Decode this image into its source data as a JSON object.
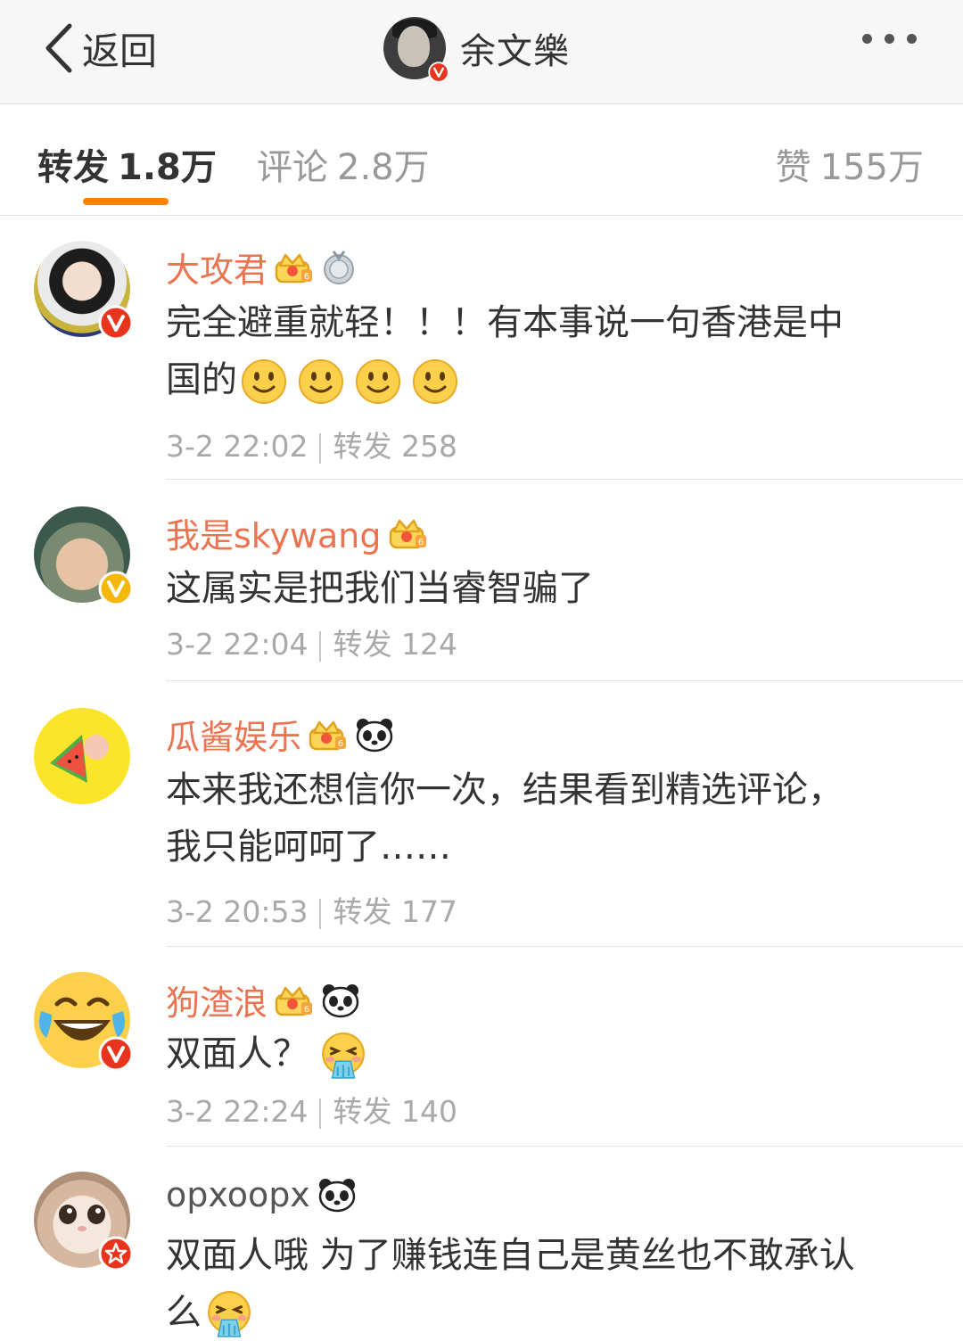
{
  "header": {
    "back_label": "返回",
    "title": "余文樂",
    "more_icon": "more-dots-icon"
  },
  "tabs": [
    {
      "label": "转发",
      "count": "1.8万",
      "active": true
    },
    {
      "label": "评论",
      "count": "2.8万",
      "active": false
    },
    {
      "label": "赞",
      "count": "155万",
      "active": false
    }
  ],
  "colors": {
    "accent": "#ff8200",
    "username": "#eb7350",
    "verified_red": "#e8341c",
    "verified_yellow": "#f5b70a"
  },
  "comments": [
    {
      "username": "大攻君",
      "badges": [
        "crown-vip-icon",
        "medal-icon"
      ],
      "verify": "verified-red-icon",
      "text_line1": "完全避重就轻！！！有本事说一句香港是中",
      "text_line2": "国的",
      "emoji": [
        "smile-emoji-icon",
        "smile-emoji-icon",
        "smile-emoji-icon",
        "smile-emoji-icon"
      ],
      "time": "3-2 22:02",
      "repost_label": "转发",
      "repost_count": "258"
    },
    {
      "username": "我是skywang",
      "badges": [
        "crown-vip-icon"
      ],
      "verify": "verified-yellow-icon",
      "text_line1": "这属实是把我们当睿智骗了",
      "time": "3-2 22:04",
      "repost_label": "转发",
      "repost_count": "124"
    },
    {
      "username": "瓜酱娱乐",
      "badges": [
        "crown-vip-icon",
        "panda-icon"
      ],
      "verify": "",
      "text_line1": "本来我还想信你一次，结果看到精选评论，",
      "text_line2": "我只能呵呵了……",
      "time": "3-2 20:53",
      "repost_label": "转发",
      "repost_count": "177"
    },
    {
      "username": "狗渣浪",
      "badges": [
        "crown-vip-icon",
        "panda-icon"
      ],
      "verify": "verified-red-icon",
      "text_line1": "双面人？",
      "emoji": [
        "vomit-emoji-icon"
      ],
      "time": "3-2 22:24",
      "repost_label": "转发",
      "repost_count": "140"
    },
    {
      "username": "opxoopx",
      "badges": [
        "panda-icon"
      ],
      "verify": "star-badge-icon",
      "text_line1": "双面人哦 为了赚钱连自己是黄丝也不敢承认",
      "text_line2": "么",
      "emoji": [
        "vomit-emoji-icon"
      ]
    }
  ]
}
